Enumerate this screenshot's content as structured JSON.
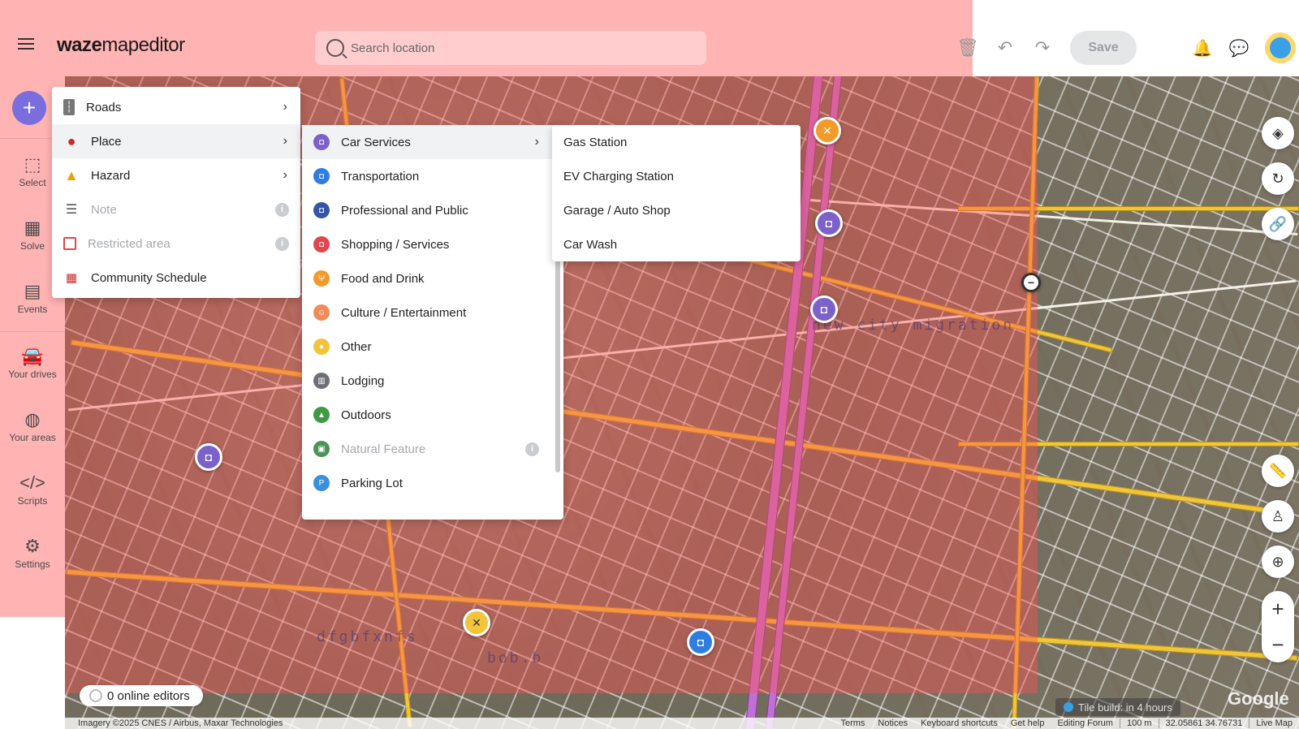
{
  "header": {
    "logo_bold": "waze",
    "logo_light": "mapeditor",
    "search_placeholder": "Search location",
    "save_label": "Save"
  },
  "sidebar": {
    "items": [
      {
        "label": "Select",
        "icon": "select-icon"
      },
      {
        "label": "Solve",
        "icon": "solve-icon"
      },
      {
        "label": "Events",
        "icon": "calendar-icon"
      },
      {
        "label": "Your drives",
        "icon": "car-icon"
      },
      {
        "label": "Your areas",
        "icon": "globe-icon"
      },
      {
        "label": "Scripts",
        "icon": "code-icon"
      },
      {
        "label": "Settings",
        "icon": "gear-icon"
      }
    ]
  },
  "menu_main": {
    "items": [
      {
        "label": "Roads",
        "submenu": true,
        "disabled": false
      },
      {
        "label": "Place",
        "submenu": true,
        "disabled": false,
        "active": true
      },
      {
        "label": "Hazard",
        "submenu": true,
        "disabled": false
      },
      {
        "label": "Note",
        "submenu": false,
        "disabled": true,
        "info": true
      },
      {
        "label": "Restricted area",
        "submenu": false,
        "disabled": true,
        "info": true
      },
      {
        "label": "Community Schedule",
        "submenu": false,
        "disabled": false
      }
    ]
  },
  "menu_place": {
    "items": [
      {
        "label": "Car Services",
        "color": "#7b61c9",
        "submenu": true,
        "active": true
      },
      {
        "label": "Transportation",
        "color": "#2f7de0"
      },
      {
        "label": "Professional and Public",
        "color": "#3456a8"
      },
      {
        "label": "Shopping / Services",
        "color": "#e0474c"
      },
      {
        "label": "Food and Drink",
        "color": "#f29a2a"
      },
      {
        "label": "Culture / Entertainment",
        "color": "#f08c5a"
      },
      {
        "label": "Other",
        "color": "#f2c43a"
      },
      {
        "label": "Lodging",
        "color": "#6d6f76"
      },
      {
        "label": "Outdoors",
        "color": "#3f9a44"
      },
      {
        "label": "Natural Feature",
        "color": "#4a9456",
        "disabled": true,
        "info": true
      },
      {
        "label": "Parking Lot",
        "color": "#3a8fe0"
      }
    ]
  },
  "menu_car_services": {
    "items": [
      {
        "label": "Gas Station"
      },
      {
        "label": "EV Charging Station"
      },
      {
        "label": "Garage / Auto Shop"
      },
      {
        "label": "Car Wash"
      }
    ]
  },
  "map": {
    "labels": [
      "new city migration",
      "dfgbfxnfs",
      "bob.b"
    ]
  },
  "status": {
    "online_editors": "0 online editors",
    "tile_build": "Tile build: in 4 hours",
    "google": "Google"
  },
  "footer": {
    "imagery": "Imagery ©2025 CNES / Airbus, Maxar Technologies",
    "links": [
      "Terms",
      "Notices",
      "Keyboard shortcuts",
      "Get help",
      "Editing Forum"
    ],
    "scale": "100 m",
    "coords": "32.05861 34.76731",
    "live_map": "Live Map"
  }
}
